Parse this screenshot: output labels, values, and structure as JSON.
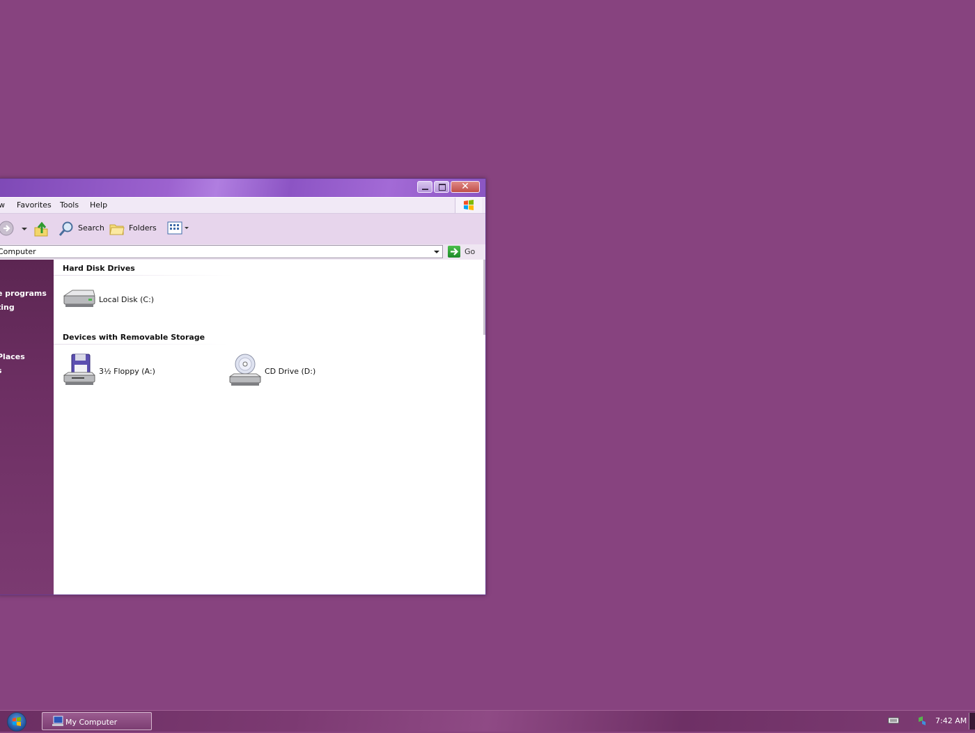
{
  "window": {
    "menu": [
      "w",
      "Favorites",
      "Tools",
      "Help"
    ],
    "toolbar": {
      "search": "Search",
      "folders": "Folders"
    },
    "address": {
      "value": "Computer",
      "go": "Go"
    },
    "side_links": [
      "e programs",
      "ting",
      "Places",
      "s"
    ],
    "groups": [
      {
        "title": "Hard Disk Drives",
        "items": [
          {
            "label": "Local Disk (C:)",
            "icon": "hard-disk-icon"
          }
        ]
      },
      {
        "title": "Devices with Removable Storage",
        "items": [
          {
            "label": "3½ Floppy (A:)",
            "icon": "floppy-drive-icon"
          },
          {
            "label": "CD Drive (D:)",
            "icon": "cd-drive-icon"
          }
        ]
      }
    ],
    "close_glyph": "✕"
  },
  "taskbar": {
    "task": "My Computer",
    "clock": "7:42 AM"
  }
}
